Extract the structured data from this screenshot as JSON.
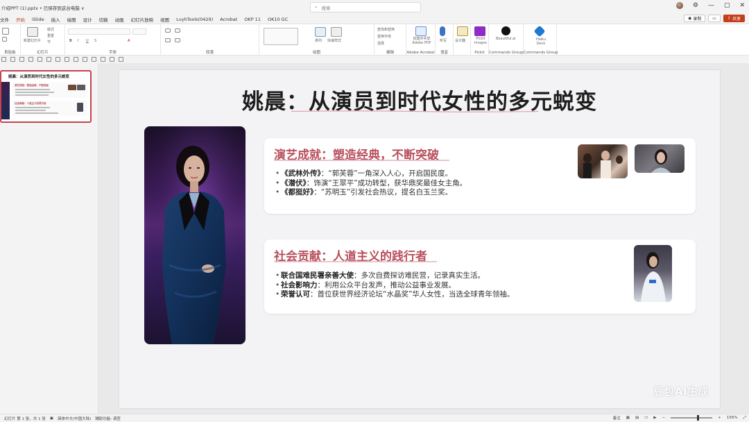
{
  "window": {
    "doc_title": "介绍PPT (1).pptx • 已保存到这台电脑 ∨",
    "search_placeholder": "搜索",
    "min": "—",
    "max": "▢",
    "close": "✕"
  },
  "tabs": [
    "文件",
    "开始",
    "iSlide",
    "插入",
    "绘图",
    "设计",
    "切换",
    "动画",
    "幻灯片放映",
    "视图",
    "LvyhTools(0429)",
    "Acrobat",
    "OKP 11",
    "OK10 GC"
  ],
  "tab_right": {
    "record": "录制",
    "comment": "",
    "share": "共享"
  },
  "ribbon": {
    "groups": [
      "剪贴板",
      "幻灯片",
      "字体",
      "段落",
      "绘图",
      "编辑",
      "Adobe Acrobat",
      "语音",
      "Pickit",
      "Commands Group",
      "Commands Group"
    ],
    "slides_new": "新建幻灯片",
    "layout": "版式",
    "reset": "重置",
    "section": "节",
    "arrange": "排列",
    "quick_styles": "快速样式",
    "find": "查找和替换",
    "replace_font": "替换字体",
    "select": "选择",
    "adobe_pdf": "创建并共享Adobe PDF",
    "dictate": "听写",
    "design": "设计器",
    "pickit": "Pickit Images",
    "beautiful": "Beautiful.ai",
    "haiku": "Haiku Deck"
  },
  "thumbnail": {
    "number": "1",
    "title": "姚晨：从演员到时代女性的多元蜕变",
    "card1": "演艺成就：塑造经典，不断突破",
    "card2": "社会贡献：人道主义的践行者"
  },
  "slide": {
    "title": "姚晨：从演员到时代女性的多元蜕变",
    "card1": {
      "title": "演艺成就：塑造经典，不断突破",
      "bullets": [
        {
          "dot": "•",
          "work": "《武林外传》",
          "text": "：“郭芙蓉”一角深入人心，开启国民度。"
        },
        {
          "dot": "•",
          "work": "《潜伏》",
          "text": "：饰演“王翠平”成功转型，获华鼎奖最佳女主角。"
        },
        {
          "dot": "•",
          "work": "《都挺好》",
          "text": "：“苏明玉”引发社会热议，提名白玉兰奖。"
        }
      ]
    },
    "card2": {
      "title": "社会贡献：人道主义的践行者",
      "bullets": [
        {
          "dot": "•",
          "label": "联合国难民署亲善大使",
          "text": "：多次自费探访难民营，记录真实生活。"
        },
        {
          "dot": "•",
          "label": "社会影响力",
          "text": "：利用公众平台发声，推动公益事业发展。"
        },
        {
          "dot": "•",
          "label": "荣誉认可",
          "text": "：首位获世界经济论坛“水晶奖”华人女性，当选全球青年领袖。"
        }
      ]
    },
    "watermark": "豆包AI生成"
  },
  "statusbar": {
    "slide_info": "幻灯片 第 1 张，共 1 张",
    "language": "简体中文(中国大陆)",
    "accessibility": "辅助功能: 调查",
    "notes": "备注",
    "zoom": "156%"
  },
  "colors": {
    "accent": "#c9414e",
    "card_title": "#b8505e",
    "share": "#c43e1c"
  }
}
